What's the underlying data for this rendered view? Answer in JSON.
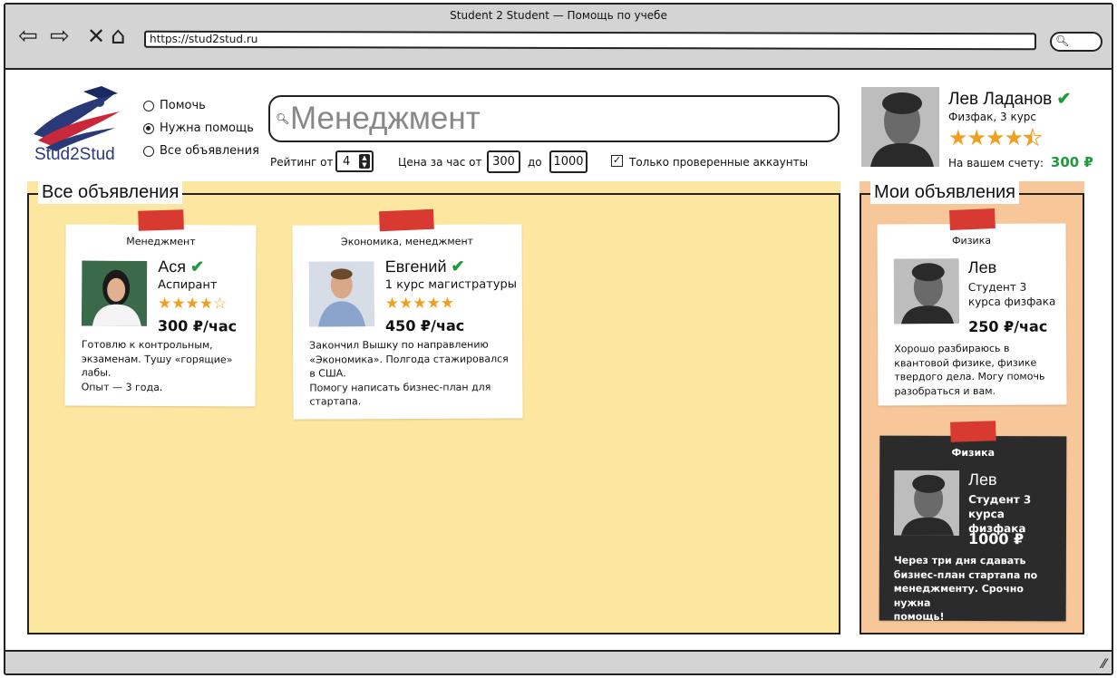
{
  "browser": {
    "title": "Student 2 Student — Помощь по учебе",
    "url": "https://stud2stud.ru"
  },
  "logo": {
    "text": "Stud2Stud"
  },
  "mode": {
    "options": [
      {
        "label": "Помочь",
        "selected": false
      },
      {
        "label": "Нужна помощь",
        "selected": true
      },
      {
        "label": "Все объявления",
        "selected": false
      }
    ]
  },
  "search": {
    "value": "Менеджмент"
  },
  "filters": {
    "rating_label": "Рейтинг от",
    "rating_value": "4",
    "price_label": "Цена за час от",
    "price_from": "300",
    "price_to_label": "до",
    "price_to": "1000",
    "verified_label": "Только проверенные аккаунты",
    "verified_checked": true
  },
  "profile": {
    "name": "Лев Ладанов",
    "subtitle": "Физфак, 3 курс",
    "rating": 4.5,
    "balance_label": "На вашем счету:",
    "balance": "300 ₽"
  },
  "all_ads": {
    "title": "Все объявления",
    "cards": [
      {
        "category": "Менеджмент",
        "name": "Ася",
        "verified": true,
        "role": "Аспирант",
        "rating": 4,
        "price": "300 ₽/час",
        "description": [
          "Готовлю к контрольным,",
          "экзаменам. Тушу «горящие»",
          "лабы.",
          "Опыт — 3 года."
        ]
      },
      {
        "category": "Экономика, менеджмент",
        "name": "Евгений",
        "verified": true,
        "role": "1 курс магистратуры",
        "rating": 5,
        "price": "450 ₽/час",
        "description": [
          "Закончил Вышку по направлению",
          "«Экономика». Полгода стажировался",
          "в США.",
          "Помогу написать бизнес-план для",
          "стартапа."
        ]
      }
    ]
  },
  "my_ads": {
    "title": "Мои объявления",
    "cards": [
      {
        "category": "Физика",
        "name": "Лев",
        "role": "Студент 3 курса физфака",
        "price": "250 ₽/час",
        "description": [
          "Хорошо разбираюсь в",
          "квантовой физике, физике",
          "твердого дела. Могу помочь",
          "разобраться и вам."
        ]
      },
      {
        "category": "Физика",
        "name": "Лев",
        "role": "Студент 3 курса физфака",
        "price": "1000 ₽",
        "description": [
          "Через три дня сдавать",
          "бизнес-план стартапа по",
          "менеджменту. Срочно нужна",
          "помощь!"
        ]
      }
    ]
  }
}
